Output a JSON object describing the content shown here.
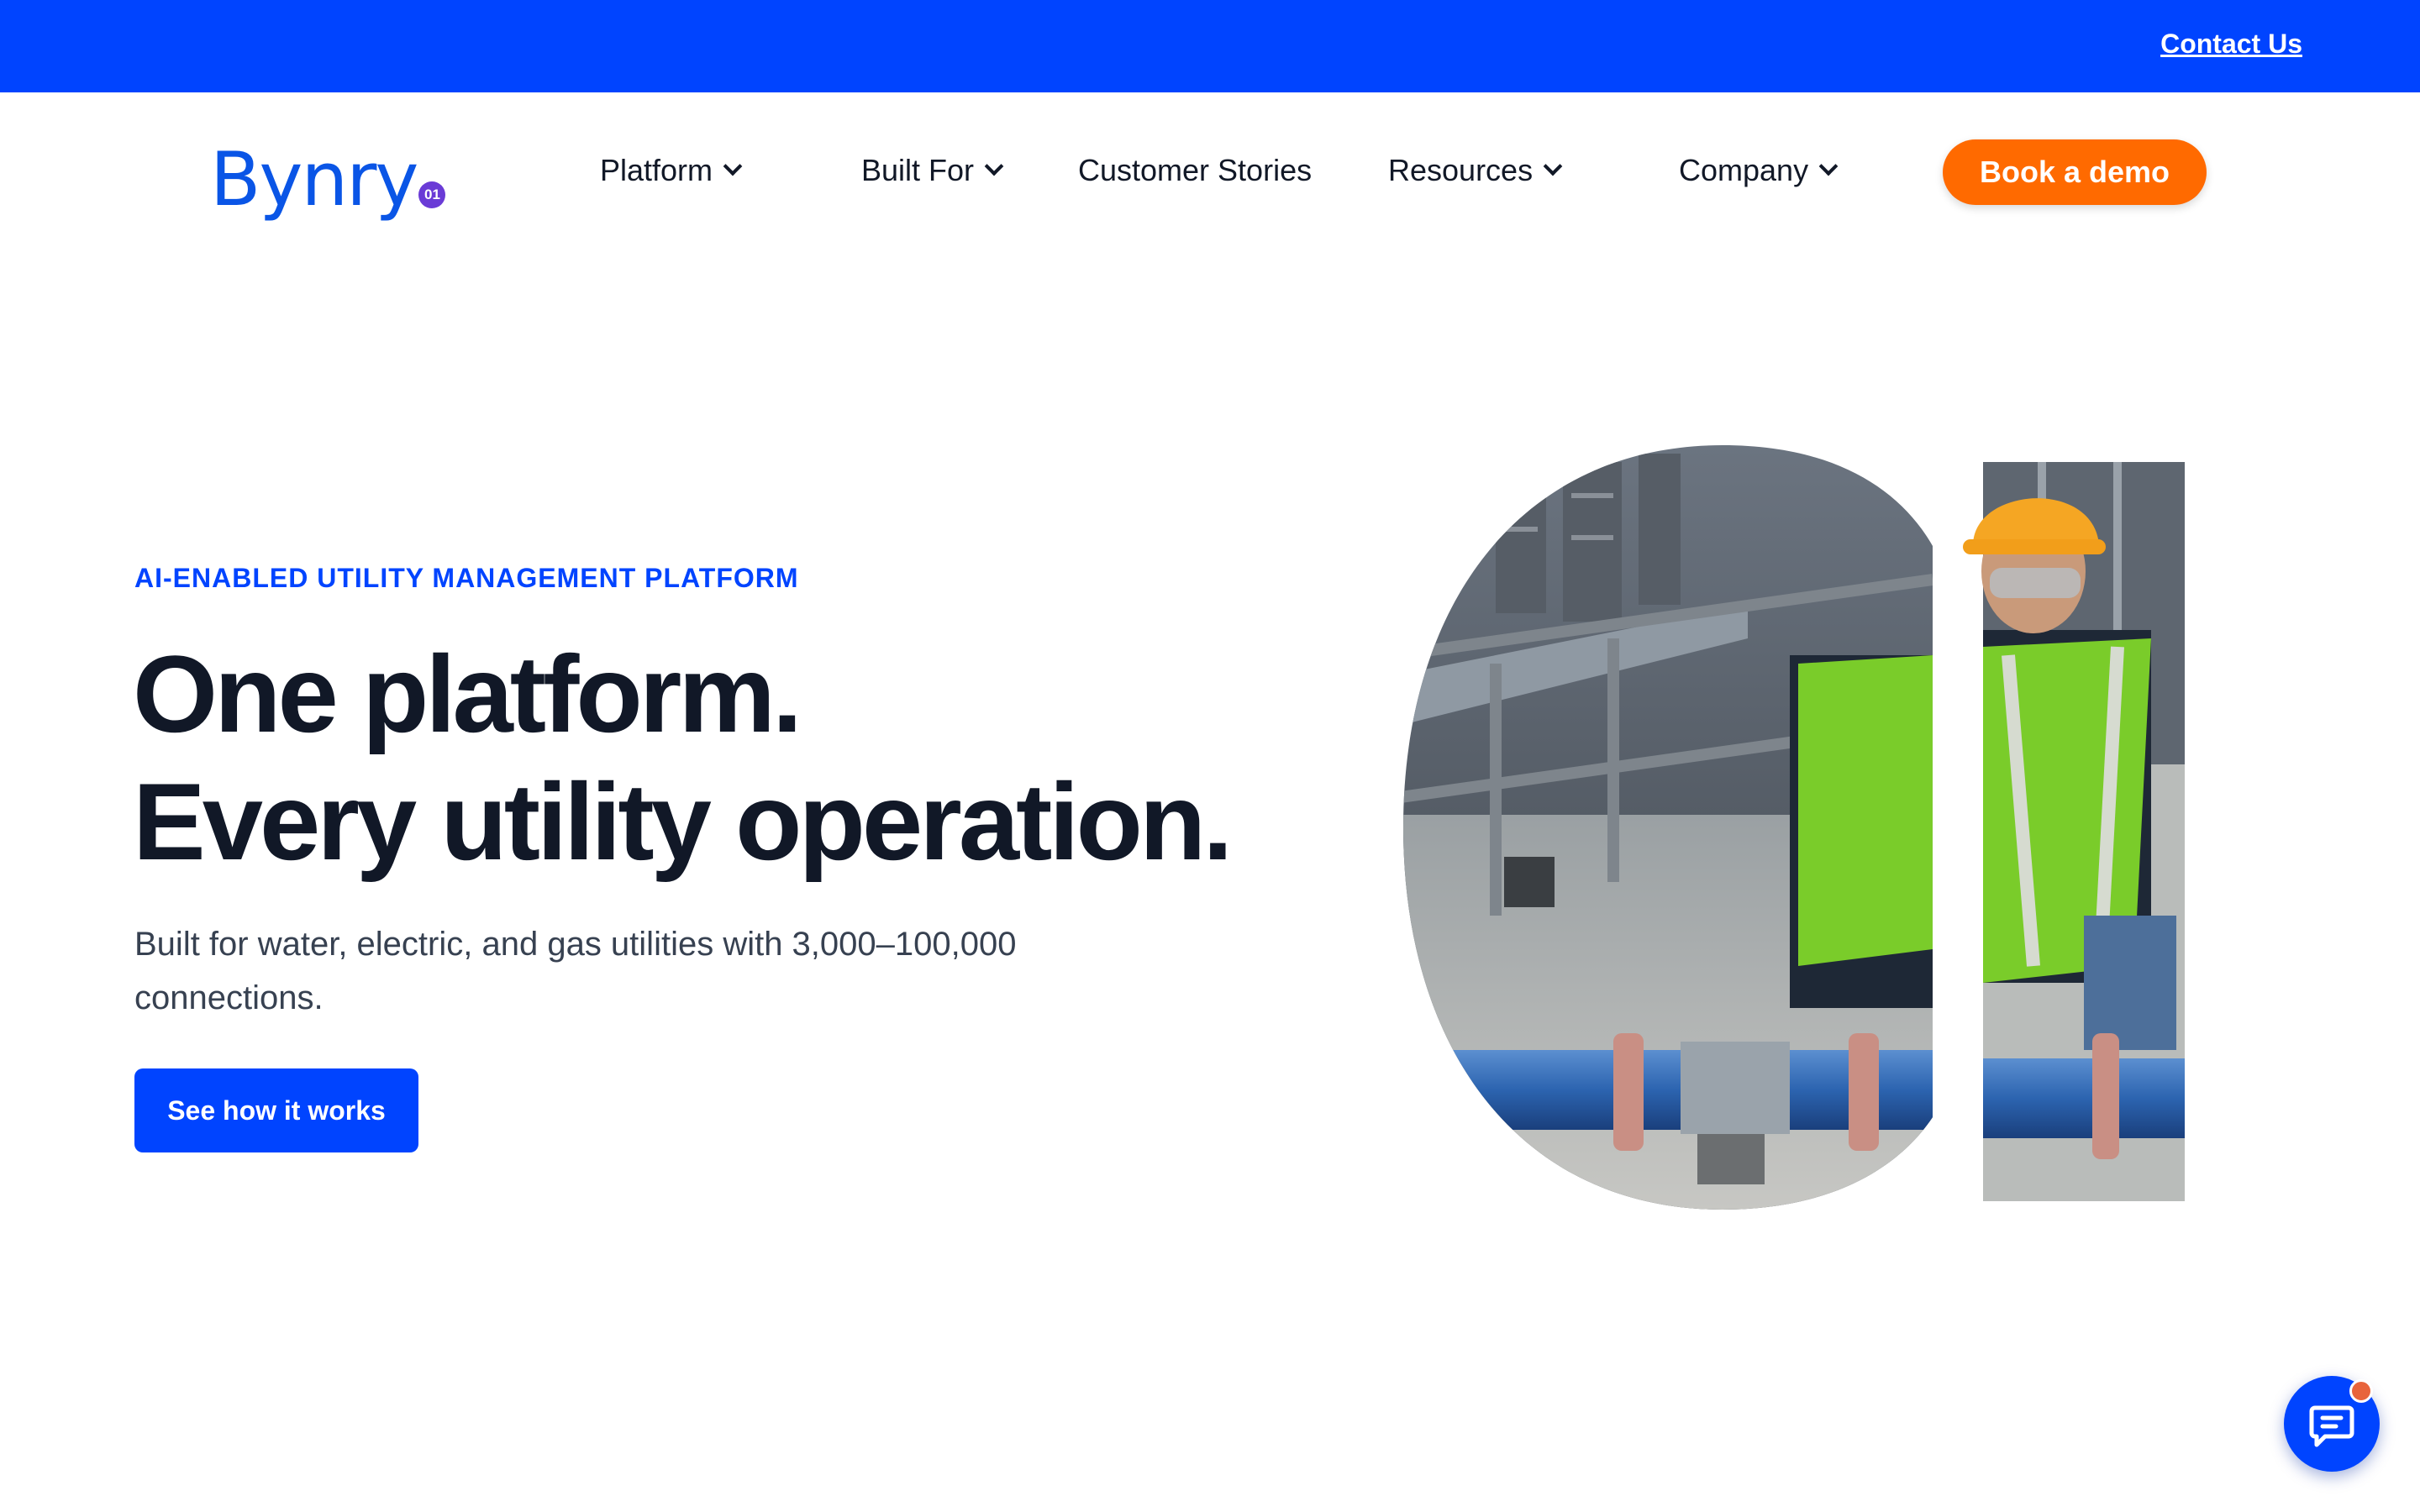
{
  "topbar": {
    "contact_label": "Contact Us",
    "background": "#0044ff"
  },
  "logo": {
    "text": "Bynry",
    "badge": "01"
  },
  "nav": {
    "items": [
      {
        "label": "Platform",
        "has_dropdown": true
      },
      {
        "label": "Built For",
        "has_dropdown": true
      },
      {
        "label": "Customer Stories",
        "has_dropdown": false
      },
      {
        "label": "Resources",
        "has_dropdown": true
      },
      {
        "label": "Company",
        "has_dropdown": true
      }
    ],
    "demo_label": "Book a demo",
    "demo_color": "#ff6a00"
  },
  "hero": {
    "eyebrow": "AI-ENABLED UTILITY MANAGEMENT PLATFORM",
    "headline_line1": "One platform.",
    "headline_line2": "Every utility operation.",
    "subtext": "Built for water, electric, and gas utilities with 3,000–100,000 connections.",
    "cta_label": "See how it works",
    "accent": "#0044ff"
  },
  "icons": {
    "chevron": "chevron-down-icon",
    "chat": "chat-icon"
  }
}
